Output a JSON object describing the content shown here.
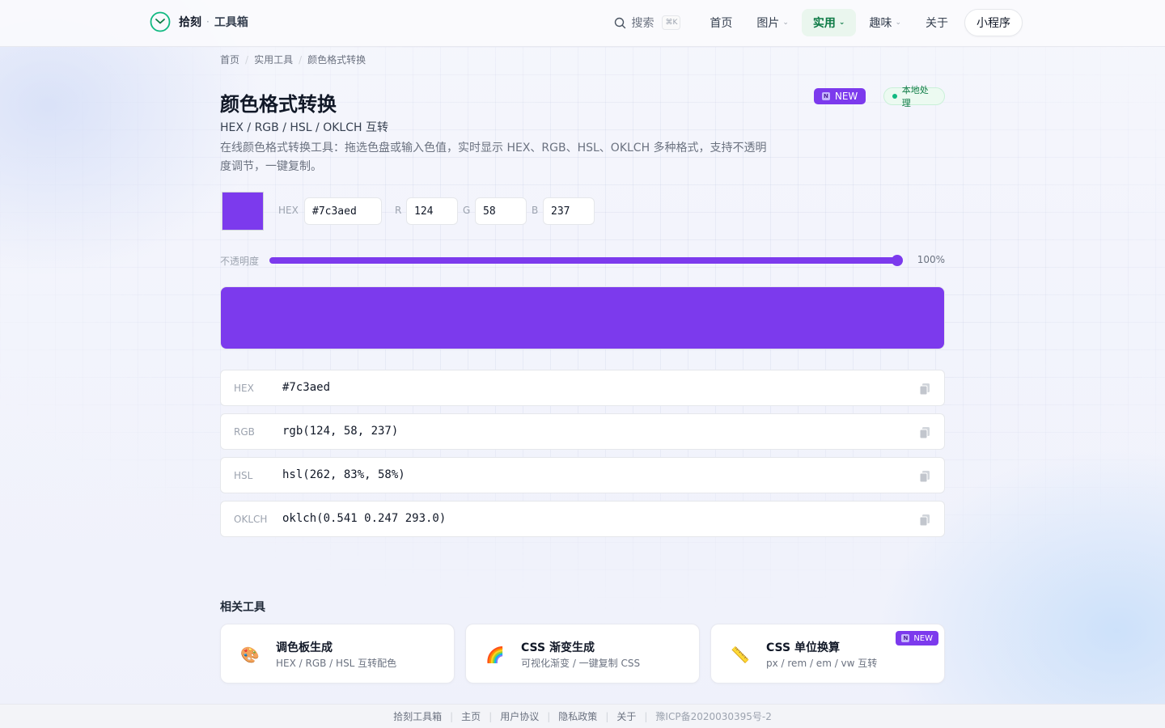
{
  "header": {
    "brand_name": "拾刻",
    "brand_sub": "工具箱",
    "search_label": "搜索",
    "search_kbd": "⌘K",
    "nav": [
      {
        "label": "首页",
        "dropdown": false
      },
      {
        "label": "图片",
        "dropdown": true
      },
      {
        "label": "实用",
        "dropdown": true,
        "active": true
      },
      {
        "label": "趣味",
        "dropdown": true
      },
      {
        "label": "关于",
        "dropdown": false
      }
    ],
    "mini_program": "小程序"
  },
  "breadcrumb": [
    "首页",
    "实用工具",
    "颜色格式转换"
  ],
  "page": {
    "title": "颜色格式转换",
    "subtitle": "HEX / RGB / HSL / OKLCH 互转",
    "description": "在线颜色格式转换工具：拖选色盘或输入色值，实时显示 HEX、RGB、HSL、OKLCH 多种格式，支持不透明度调节，一键复制。",
    "badge_new": "NEW",
    "badge_n": "N",
    "badge_local": "本地处理"
  },
  "color": {
    "hex_label": "HEX",
    "hex": "#7c3aed",
    "r_label": "R",
    "r": "124",
    "g_label": "G",
    "g": "58",
    "b_label": "B",
    "b": "237",
    "swatch_color": "#7c3aed"
  },
  "opacity": {
    "label": "不透明度",
    "value_text": "100%",
    "value": 1.0
  },
  "formats": [
    {
      "name": "HEX",
      "value": "#7c3aed"
    },
    {
      "name": "RGB",
      "value": "rgb(124, 58, 237)"
    },
    {
      "name": "HSL",
      "value": "hsl(262, 83%, 58%)"
    },
    {
      "name": "OKLCH",
      "value": "oklch(0.541 0.247 293.0)"
    }
  ],
  "related": {
    "title": "相关工具",
    "cards": [
      {
        "title": "调色板生成",
        "sub": "HEX / RGB / HSL 互转配色",
        "icon": "palette-icon",
        "glyph": "🎨"
      },
      {
        "title": "CSS 渐变生成",
        "sub": "可视化渐变 / 一键复制 CSS",
        "icon": "rainbow-icon",
        "glyph": "🌈"
      },
      {
        "title": "CSS 单位换算",
        "sub": "px / rem / em / vw 互转",
        "icon": "ruler-icon",
        "glyph": "📏",
        "badge": "NEW"
      }
    ]
  },
  "footer": {
    "links": [
      "拾刻工具箱",
      "主页",
      "用户协议",
      "隐私政策",
      "关于"
    ],
    "icp": "豫ICP备2020030395号-2"
  },
  "colors": {
    "accent": "#7c3aed",
    "brand_green": "#10b981",
    "active_nav_text": "#0d7a45"
  }
}
